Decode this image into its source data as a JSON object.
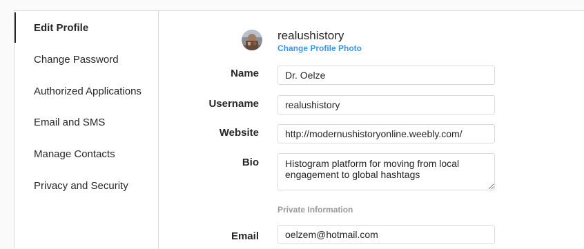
{
  "sidebar": {
    "items": [
      {
        "label": "Edit Profile",
        "active": true
      },
      {
        "label": "Change Password",
        "active": false
      },
      {
        "label": "Authorized Applications",
        "active": false
      },
      {
        "label": "Email and SMS",
        "active": false
      },
      {
        "label": "Manage Contacts",
        "active": false
      },
      {
        "label": "Privacy and Security",
        "active": false
      }
    ]
  },
  "profile": {
    "username": "realushistory",
    "change_photo_label": "Change Profile Photo",
    "avatar_icon": "profile-photo"
  },
  "form": {
    "name": {
      "label": "Name",
      "value": "Dr. Oelze"
    },
    "username": {
      "label": "Username",
      "value": "realushistory"
    },
    "website": {
      "label": "Website",
      "value": "http://modernushistoryonline.weebly.com/"
    },
    "bio": {
      "label": "Bio",
      "value": "Histogram platform for moving from local engagement to global hashtags"
    },
    "private_section_title": "Private Information",
    "email": {
      "label": "Email",
      "value": "oelzem@hotmail.com"
    }
  },
  "colors": {
    "link": "#3897f0",
    "border": "#dbdbdb",
    "text": "#262626",
    "muted": "#999999"
  }
}
